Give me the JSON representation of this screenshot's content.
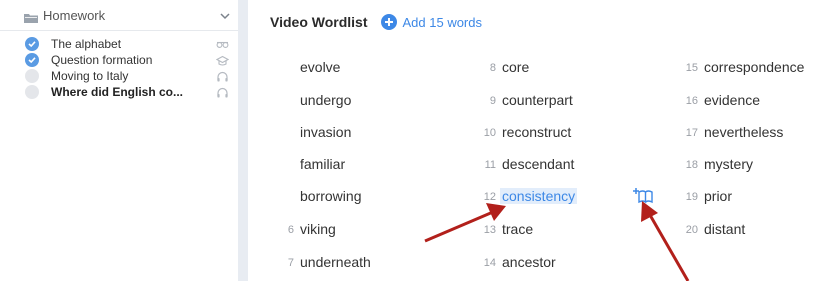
{
  "sidebar": {
    "header_title": "Homework",
    "items": [
      {
        "label": "The alphabet",
        "done": true,
        "bold": false,
        "type_icon": "video-icon"
      },
      {
        "label": "Question formation",
        "done": true,
        "bold": false,
        "type_icon": "graduation-cap-icon"
      },
      {
        "label": "Moving to Italy",
        "done": false,
        "bold": false,
        "type_icon": "headphones-icon"
      },
      {
        "label": "Where did English co...",
        "done": false,
        "bold": true,
        "type_icon": "headphones-icon"
      }
    ]
  },
  "wordlist": {
    "title": "Video Wordlist",
    "add_label": "Add 15 words",
    "accent_color": "#3d88e6",
    "col1": [
      {
        "num": "",
        "word": "evolve"
      },
      {
        "num": "",
        "word": "undergo"
      },
      {
        "num": "",
        "word": "invasion"
      },
      {
        "num": "",
        "word": "familiar"
      },
      {
        "num": "",
        "word": "borrowing"
      },
      {
        "num": "6",
        "word": "viking"
      },
      {
        "num": "7",
        "word": "underneath"
      }
    ],
    "col2": [
      {
        "num": "8",
        "word": "core"
      },
      {
        "num": "9",
        "word": "counterpart"
      },
      {
        "num": "10",
        "word": "reconstruct"
      },
      {
        "num": "11",
        "word": "descendant"
      },
      {
        "num": "12",
        "word": "consistency",
        "highlighted": true
      },
      {
        "num": "13",
        "word": "trace"
      },
      {
        "num": "14",
        "word": "ancestor"
      }
    ],
    "col3": [
      {
        "num": "15",
        "word": "correspondence"
      },
      {
        "num": "16",
        "word": "evidence"
      },
      {
        "num": "17",
        "word": "nevertheless"
      },
      {
        "num": "18",
        "word": "mystery"
      },
      {
        "num": "19",
        "word": "prior"
      },
      {
        "num": "20",
        "word": "distant"
      }
    ],
    "add_to_dictionary_icon": "add-to-book-icon"
  },
  "annotation_color": "#b2201b"
}
